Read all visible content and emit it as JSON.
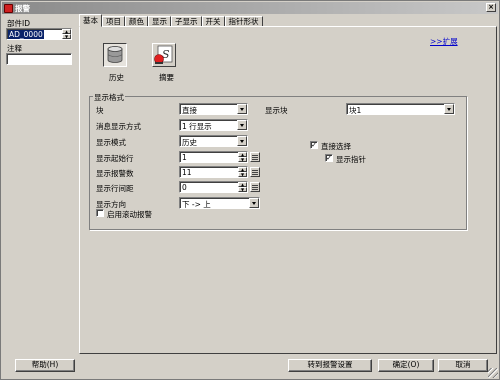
{
  "window": {
    "title": "报警",
    "close_glyph": "×"
  },
  "left": {
    "part_id_label": "部件ID",
    "part_id_value": "AD_0000",
    "comment_label": "注释",
    "comment_value": ""
  },
  "tabs": [
    "基本",
    "项目",
    "颜色",
    "显示",
    "子显示",
    "开关",
    "指针形状"
  ],
  "link_expand": ">>扩展",
  "icons": [
    {
      "label": "历史",
      "icon": "database-icon",
      "selected": true
    },
    {
      "label": "摘要",
      "icon": "alarm-summary-icon",
      "selected": false
    }
  ],
  "group": {
    "title": "显示格式",
    "block_label": "块",
    "block_value": "直接",
    "display_block_label": "显示块",
    "display_block_value": "块1",
    "msg_mode_label": "消息显示方式",
    "msg_mode_value": "1 行显示",
    "display_mode_label": "显示模式",
    "display_mode_value": "历史",
    "start_row_label": "显示起始行",
    "start_row_value": "1",
    "alarm_count_label": "显示报警数",
    "alarm_count_value": "11",
    "row_spacing_label": "显示行间距",
    "row_spacing_value": "0",
    "direction_label": "显示方向",
    "direction_value": "下 -> 上",
    "scroll_alarm_label": "启用滚动报警",
    "scroll_alarm_checked": false,
    "direct_select_label": "直接选择",
    "direct_select_checked": true,
    "show_pointer_label": "显示指针",
    "show_pointer_checked": true,
    "check_glyph": "✓"
  },
  "buttons": {
    "help": "帮助(H)",
    "goto_alarm": "转到报警设置",
    "ok": "确定(O)",
    "cancel": "取消"
  }
}
